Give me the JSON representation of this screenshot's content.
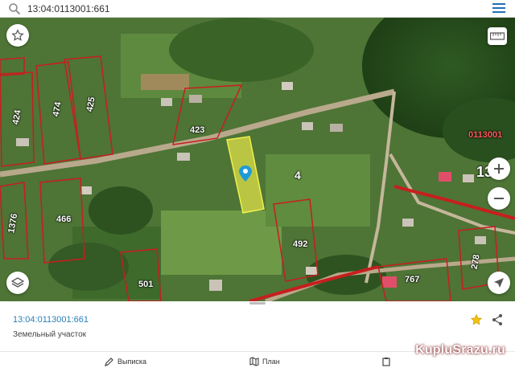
{
  "search": {
    "query": "13:04:0113001:661"
  },
  "map": {
    "parcel_labels": [
      "424",
      "474",
      "425",
      "423",
      "4",
      "1376",
      "466",
      "492",
      "501",
      "767",
      "278",
      "0113001",
      "13"
    ],
    "colors": {
      "boundary": "#c81e1e",
      "selected_fill": "#e8e84a",
      "marker": "#1e9bd7"
    }
  },
  "info": {
    "cadastral_number": "13:04:0113001:661",
    "object_type": "Земельный участок"
  },
  "nav": {
    "extract_label": "Выписка",
    "plan_label": "План",
    "third_label": ""
  },
  "watermark": {
    "text": "KupluSrazu.ru"
  },
  "icons": [
    "search-icon",
    "menu-icon",
    "star-icon",
    "ruler-icon",
    "zoom-in-icon",
    "zoom-out-icon",
    "layers-icon",
    "locate-icon",
    "share-icon",
    "pen-icon",
    "map-icon",
    "clipboard-icon"
  ]
}
